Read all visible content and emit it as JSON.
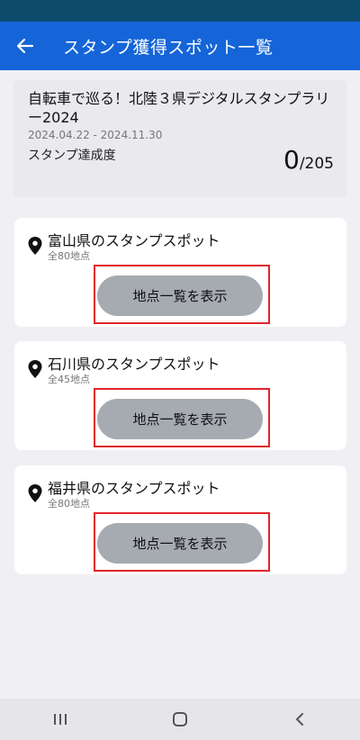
{
  "app_bar": {
    "title": "スタンプ獲得スポット一覧"
  },
  "summary": {
    "title": "自転車で巡る！北陸３県デジタルスタンプラリー2024",
    "dates": "2024.04.22 - 2024.11.30",
    "progress_label": "スタンプ達成度",
    "progress_count": "0",
    "progress_total": "/205"
  },
  "prefectures": [
    {
      "name": "富山県のスタンプスポット",
      "count": "全80地点",
      "button_label": "地点一覧を表示"
    },
    {
      "name": "石川県のスタンプスポット",
      "count": "全45地点",
      "button_label": "地点一覧を表示"
    },
    {
      "name": "福井県のスタンプスポット",
      "count": "全80地点",
      "button_label": "地点一覧を表示"
    }
  ],
  "colors": {
    "app_bar": "#1565d8",
    "status_bar": "#0d4a6b",
    "button": "#a6abb1",
    "highlight": "#e0252a"
  },
  "icons": {
    "back": "arrow-left-icon",
    "pin": "map-pin-icon",
    "nav_recents": "recents-icon",
    "nav_home": "home-icon",
    "nav_back": "chevron-left-icon"
  }
}
